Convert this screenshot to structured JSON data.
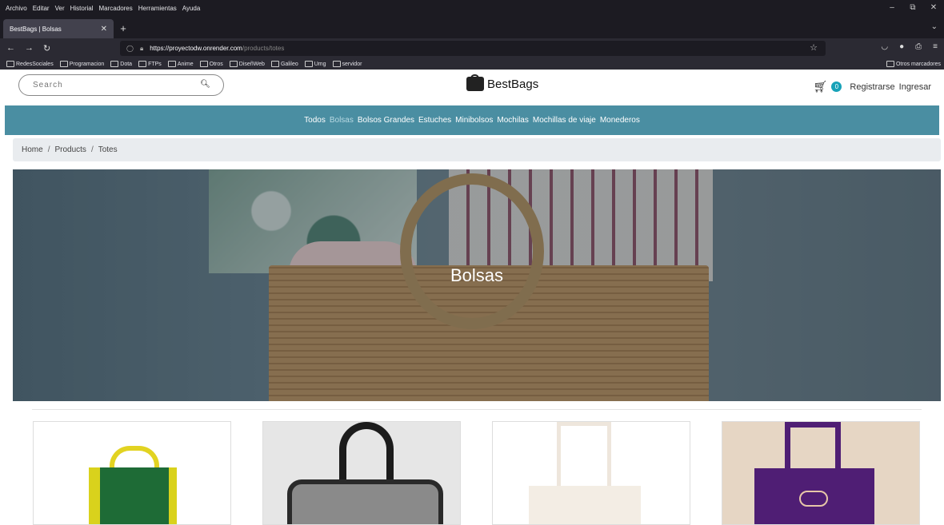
{
  "browser": {
    "menu": [
      "Archivo",
      "Editar",
      "Ver",
      "Historial",
      "Marcadores",
      "Herramientas",
      "Ayuda"
    ],
    "tab_title": "BestBags | Bolsas",
    "url_host": "https://proyectodw.onrender.com",
    "url_path": "/products/totes",
    "bookmarks": [
      "RedesSociales",
      "Programacion",
      "Dota",
      "FTPs",
      "Anime",
      "Otros",
      "DiseñWeb",
      "Galileo",
      "Umg",
      "servidor"
    ],
    "other_bookmarks": "Otros marcadores"
  },
  "site": {
    "search_placeholder": "Search",
    "brand": "BestBags",
    "cart_count": "0",
    "register": "Registrarse",
    "login": "Ingresar",
    "categories": [
      "Todos",
      "Bolsas",
      "Bolsos Grandes",
      "Estuches",
      "Minibolsos",
      "Mochilas",
      "Mochillas de viaje",
      "Monederos"
    ],
    "active_category": "Bolsas",
    "breadcrumb": [
      "Home",
      "Products",
      "Totes"
    ],
    "hero_title": "Bolsas"
  },
  "colors": {
    "nav": "#4a8ea2",
    "badge": "#17a2b8"
  }
}
